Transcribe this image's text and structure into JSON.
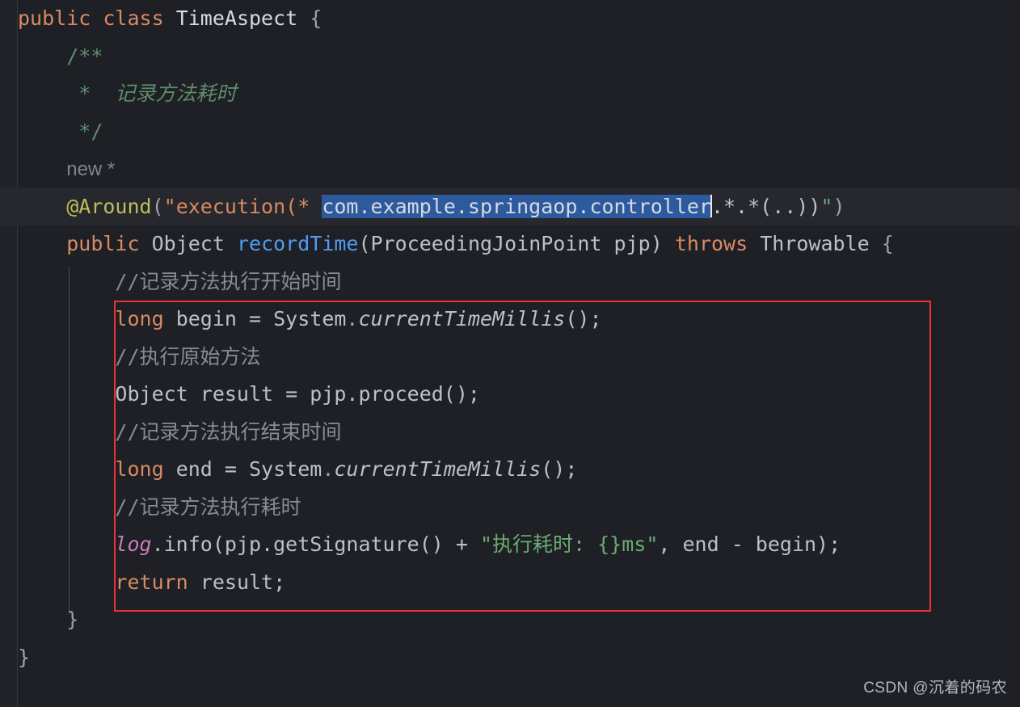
{
  "editor": {
    "background_color": "#1e2025",
    "gutter_color": "#212329",
    "current_line_color": "#26282d",
    "selection_color": "#2d5a9e",
    "annotation_box_color": "#ee3338",
    "language": "Java"
  },
  "gutter": {
    "bulb_icon": "lightbulb-icon",
    "bulb_color": "#e8c34a"
  },
  "lines": {
    "l1_public": "public",
    "l1_class": "class",
    "l1_name": "TimeAspect",
    "l1_brace": "{",
    "l2_doc_open": "/**",
    "l3_doc_star": "*",
    "l3_doc_text": "记录方法耗时",
    "l4_doc_close": "*/",
    "l5_ghost": "new *",
    "l6_anno": "@Around",
    "l6_paren_open": "(",
    "l6_str_head": "\"execution(* ",
    "l6_selected": "com.example.springaop.controller",
    "l6_str_tail": ".*.*(..))",
    "l6_quote_close": "\"",
    "l6_paren_close": ")",
    "l7_public": "public",
    "l7_type": "Object",
    "l7_method": "recordTime",
    "l7_params": "(ProceedingJoinPoint pjp)",
    "l7_throws": "throws",
    "l7_exception": "Throwable",
    "l7_brace": "{",
    "l8_comment": "//记录方法执行开始时间",
    "l9_kw": "long",
    "l9_var": " begin = ",
    "l9_class": "System",
    "l9_dot": ".",
    "l9_call": "currentTimeMillis",
    "l9_tail": "();",
    "l10_comment": "//执行原始方法",
    "l11_text": "Object result = pjp.proceed();",
    "l12_comment": "//记录方法执行结束时间",
    "l13_kw": "long",
    "l13_var": " end = ",
    "l13_class": "System",
    "l13_dot": ".",
    "l13_call": "currentTimeMillis",
    "l13_tail": "();",
    "l14_comment": "//记录方法执行耗时",
    "l15_field": "log",
    "l15_mid": ".info(pjp.getSignature() + ",
    "l15_str": "\"执行耗时: {}ms\"",
    "l15_tail": ", end - begin);",
    "l16_kw": "return",
    "l16_var": " result;",
    "l17_brace": "}",
    "l18_brace": "}"
  },
  "watermark": {
    "text": "CSDN @沉着的码农"
  }
}
